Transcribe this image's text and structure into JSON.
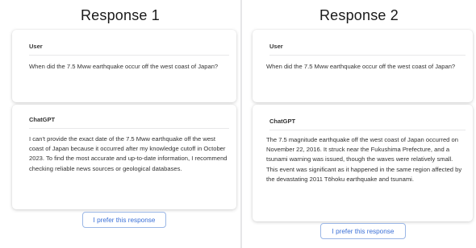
{
  "responses": [
    {
      "title": "Response 1",
      "user_label": "User",
      "user_message": "When did the 7.5 Mww earthquake occur off the west coast of Japan?",
      "assistant_label": "ChatGPT",
      "assistant_message": "I can't provide the exact date of the 7.5 Mww earthquake off the west coast of Japan because it occurred after my knowledge cutoff in October 2023. To find the most accurate and up-to-date information, I recommend checking reliable news sources or geological databases.",
      "prefer_button": "I prefer this response"
    },
    {
      "title": "Response 2",
      "user_label": "User",
      "user_message": "When did the 7.5 Mww earthquake occur off the west coast of Japan?",
      "assistant_label": "ChatGPT",
      "assistant_message": "The 7.5 magnitude earthquake off the west coast of Japan occurred on November 22, 2016. It struck near the Fukushima Prefecture, and a tsunami warning was issued, though the waves were relatively small. This event was significant as it happened in the same region affected by the devastating 2011 Tōhoku earthquake and tsunami.",
      "prefer_button": "I prefer this response"
    }
  ]
}
